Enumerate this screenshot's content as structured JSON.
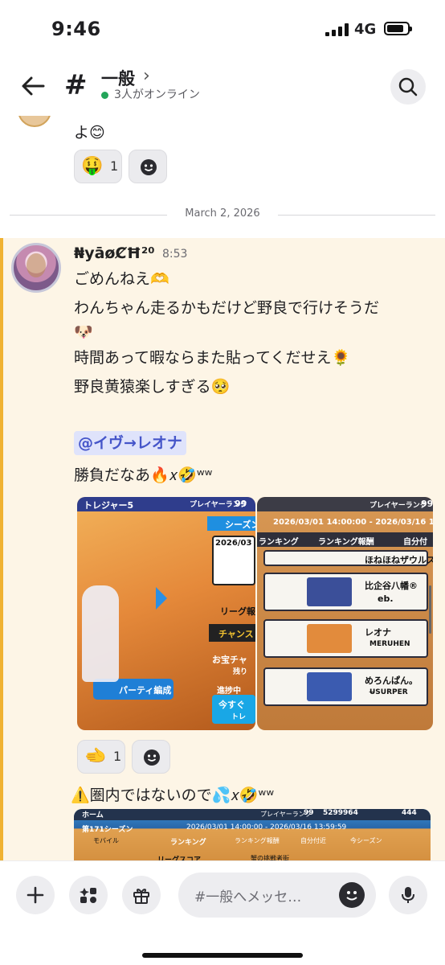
{
  "status_bar": {
    "time": "9:46",
    "network": "4G",
    "battery_level": 0.85
  },
  "header": {
    "channel_name": "一般",
    "online_text": "3人がオンライン",
    "online_color": "#23a55a"
  },
  "previous_message": {
    "text": "よ😊",
    "reaction": {
      "emoji": "🤑",
      "count": "1"
    }
  },
  "date_divider": "March 2, 2026",
  "message": {
    "author": "₦yāøȻĦ²⁰",
    "time": "8:53",
    "lines": [
      "ごめんねえ🫶",
      "わんちゃん走るかもだけど野良で行けそうだ",
      "🐶",
      "時間あって暇ならまた貼ってくだせえ🌻",
      "野良黄猿楽しすぎる🥺"
    ],
    "mention": "@イヴ→レオナ",
    "after_mention": "勝負だなあ🔥𝑥🤣ʷʷ",
    "reaction": {
      "emoji": "🫲",
      "count": "1"
    },
    "attachments": {
      "left": {
        "header": "トレジャー5",
        "rank_label": "プレイヤーランク",
        "rank_value": "99",
        "season_label": "シーズン",
        "date_text": "2026/03",
        "league_label": "リーグ報",
        "challenge_label": "チャンス",
        "treasure_label": "お宝チャ",
        "remaining_label": "残り",
        "progress_label": "進捗中",
        "party_button": "パーティ編成",
        "now_label": "今すぐ",
        "train_label": "トレ"
      },
      "right": {
        "rank_label": "プレイヤーランク",
        "rank_value": "99",
        "date_range": "2026/03/01 14:00:00 - 2026/03/16 13:59:59",
        "tab_ranking": "ランキング",
        "tab_reward": "ランキング報酬",
        "tab_self": "自分付",
        "players": [
          {
            "name": "ほねほねザウルス",
            "guild": ""
          },
          {
            "name": "比企谷八幡®",
            "guild": "eb."
          },
          {
            "name": "レオナ",
            "guild": "MERUHEN"
          },
          {
            "name": "めろんぱん。",
            "guild": "U̶SURPER"
          }
        ]
      }
    }
  },
  "next_message": {
    "text": "⚠️圏内ではないので💦𝑥🤣ʷʷ",
    "attachment": {
      "home_label": "ホーム",
      "rank_label": "プレイヤーランク",
      "rank_value": "99",
      "coins": "5299964",
      "gems": "444",
      "season_label": "第171シーズン",
      "date_range": "2026/03/01 14:00:00 - 2026/03/16 13:59:59",
      "mode_label": "モバイル",
      "tab_ranking": "ランキング",
      "tab_reward": "ランキング報酬",
      "tab_self": "自分付近",
      "tab_season": "今シーズン",
      "score_label": "リーグスコア",
      "extra_text": "蟹の挑戦者街"
    }
  },
  "composer": {
    "placeholder": "#一般へメッセ…"
  }
}
